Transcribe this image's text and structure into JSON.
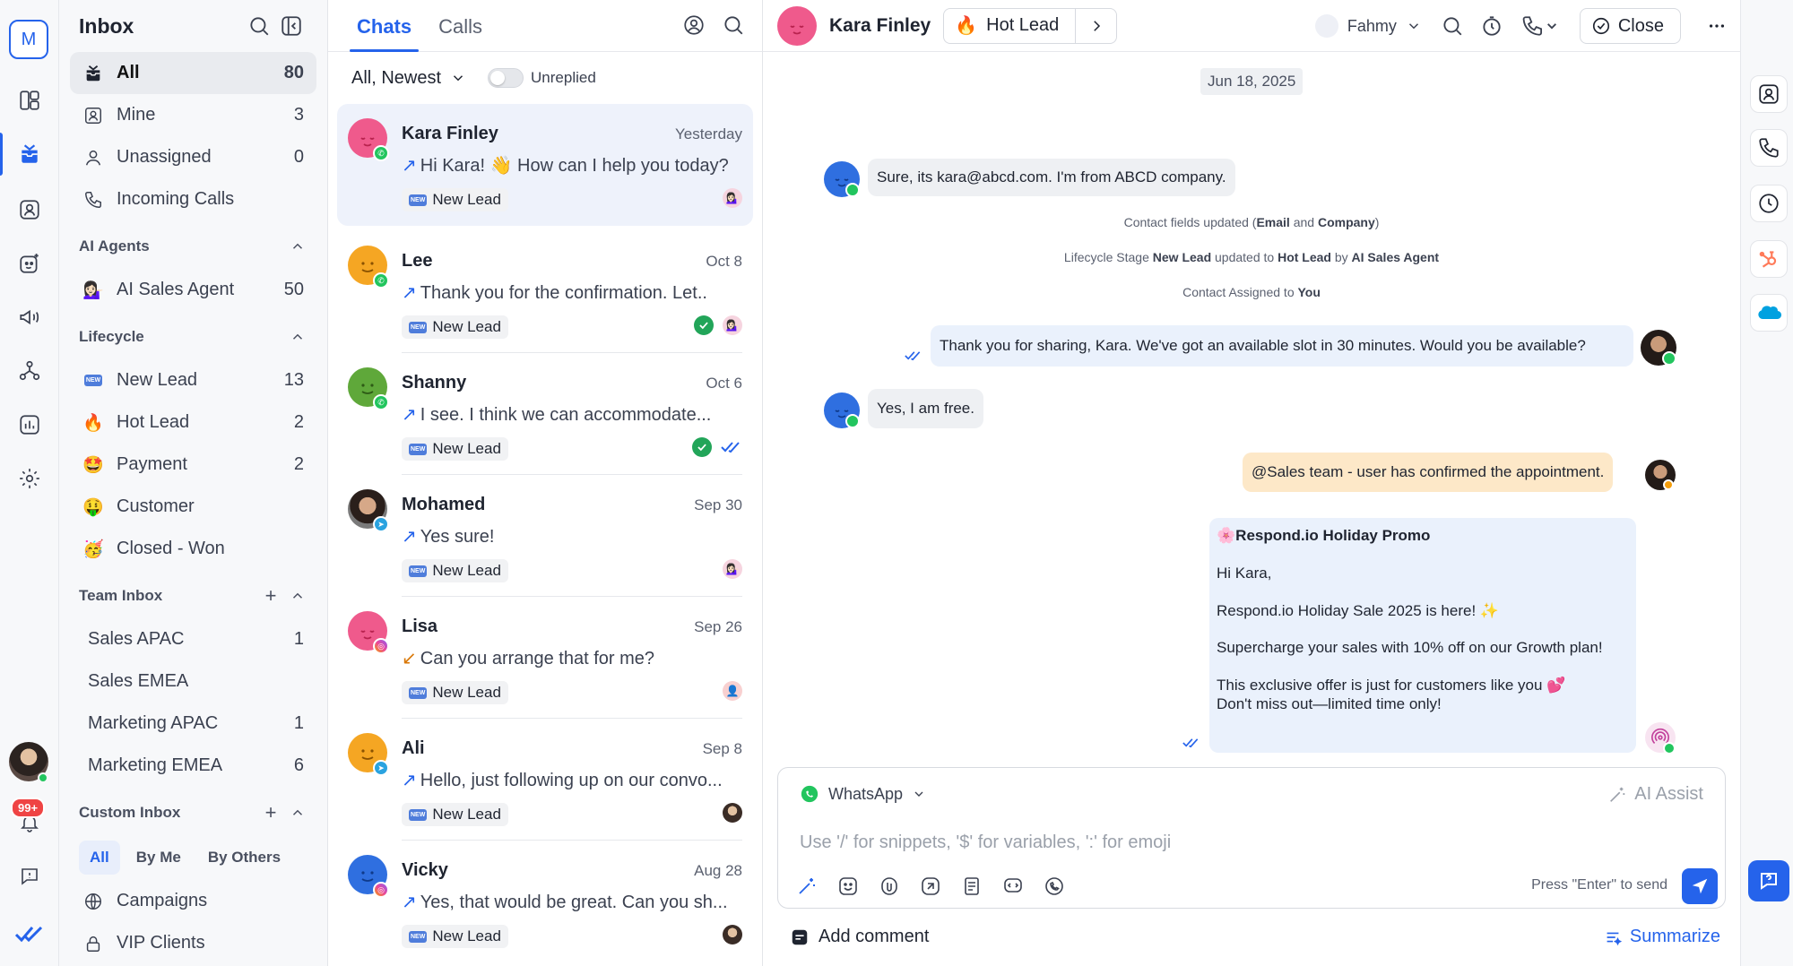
{
  "rail": {
    "org_initial": "M",
    "notifications": "99+"
  },
  "sidebar": {
    "title": "Inbox",
    "main_items": [
      {
        "label": "All",
        "count": "80"
      },
      {
        "label": "Mine",
        "count": "3"
      },
      {
        "label": "Unassigned",
        "count": "0"
      },
      {
        "label": "Incoming Calls",
        "count": ""
      }
    ],
    "ai_agents": {
      "title": "AI Agents",
      "items": [
        {
          "label": "AI Sales Agent",
          "count": "50"
        }
      ]
    },
    "lifecycle": {
      "title": "Lifecycle",
      "items": [
        {
          "label": "New Lead",
          "count": "13"
        },
        {
          "label": "Hot Lead",
          "count": "2"
        },
        {
          "label": "Payment",
          "count": "2"
        },
        {
          "label": "Customer",
          "count": ""
        },
        {
          "label": "Closed - Won",
          "count": ""
        }
      ]
    },
    "team_inbox": {
      "title": "Team Inbox",
      "items": [
        {
          "label": "Sales APAC",
          "count": "1"
        },
        {
          "label": "Sales EMEA",
          "count": ""
        },
        {
          "label": "Marketing APAC",
          "count": "1"
        },
        {
          "label": "Marketing EMEA",
          "count": "6"
        }
      ]
    },
    "custom_inbox": {
      "title": "Custom Inbox",
      "tabs": [
        "All",
        "By Me",
        "By Others"
      ],
      "items": [
        {
          "label": "Campaigns"
        },
        {
          "label": "VIP Clients"
        }
      ]
    }
  },
  "chatlist": {
    "tabs": [
      "Chats",
      "Calls"
    ],
    "sort": "All, Newest",
    "unreplied_label": "Unreplied",
    "chats": [
      {
        "name": "Kara Finley",
        "time": "Yesterday",
        "message": "Hi Kara! 👋 How can I help you today?",
        "tag": "New Lead"
      },
      {
        "name": "Lee",
        "time": "Oct 8",
        "message": "Thank you for the confirmation. Let..",
        "tag": "New Lead"
      },
      {
        "name": "Shanny",
        "time": "Oct 6",
        "message": "I see. I think we can accommodate...",
        "tag": "New Lead"
      },
      {
        "name": "Mohamed",
        "time": "Sep 30",
        "message": "Yes sure!",
        "tag": "New Lead"
      },
      {
        "name": "Lisa",
        "time": "Sep 26",
        "message": "Can you arrange that for me?",
        "tag": "New Lead"
      },
      {
        "name": "Ali",
        "time": "Sep 8",
        "message": "Hello, just following up on our convo...",
        "tag": "New Lead"
      },
      {
        "name": "Vicky",
        "time": "Aug 28",
        "message": "Yes, that would be great. Can you sh...",
        "tag": "New Lead"
      }
    ]
  },
  "conversation": {
    "contact_name": "Kara Finley",
    "lifecycle": "Hot Lead",
    "assignee": "Fahmy",
    "close_label": "Close",
    "date": "Jun 18, 2025",
    "msg1": "Sure, its kara@abcd.com. I'm from ABCD company.",
    "sys1": {
      "pre": "Contact fields updated (",
      "b1": "Email",
      "mid": " and ",
      "b2": "Company",
      "post": ")"
    },
    "sys2": {
      "pre": "Lifecycle Stage ",
      "b1": "New Lead",
      "mid": " updated to ",
      "b2": "Hot Lead",
      "mid2": " by ",
      "b3": "AI Sales Agent"
    },
    "sys3": {
      "pre": "Contact  Assigned to ",
      "b1": "You"
    },
    "msg2": "Thank you for sharing, Kara. We've got an available slot in 30 minutes. Would you be available?",
    "msg3": "Yes, I am free.",
    "note": "@Sales team - user has confirmed the appointment.",
    "promo": {
      "title": "Respond.io Holiday Promo",
      "greeting": "Hi Kara,",
      "line1": "Respond.io Holiday Sale 2025 is here! ✨",
      "line2": "Supercharge your sales with 10% off on our Growth plan!",
      "line3": "This exclusive offer is just for customers like you 💕",
      "line4": "Don't miss out—limited time only!"
    }
  },
  "composer": {
    "channel": "WhatsApp",
    "ai_assist": "AI Assist",
    "placeholder": "Use '/' for snippets, '$' for variables, ':' for emoji",
    "send_hint": "Press \"Enter\" to send",
    "add_comment": "Add comment",
    "summarize": "Summarize"
  },
  "colors": {
    "accent": "#2563eb",
    "whatsapp": "#22c55e",
    "note": "#fde8c8"
  }
}
